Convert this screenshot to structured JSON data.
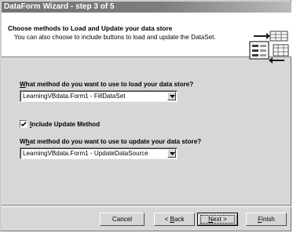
{
  "window": {
    "title": "DataForm Wizard - step 3 of 5"
  },
  "header": {
    "title": "Choose methods to Load and Update your data store",
    "subtitle": "You can also choose to include buttons to load and update the DataSet."
  },
  "load_section": {
    "label_accel": "W",
    "label_rest": "hat method do you want to use to load your data store?",
    "selected_value": "LearningVBdata.Form1  - FillDataSet"
  },
  "include_update": {
    "checked": true,
    "label_accel": "I",
    "label_rest": "nclude Update Method"
  },
  "update_section": {
    "label_prefix": "W",
    "label_accel": "h",
    "label_rest": "at method do you want to use to update your data store?",
    "selected_value": "LearningVBdata.Form1  - UpdateDataSource"
  },
  "buttons": {
    "cancel": "Cancel",
    "back_prefix": "< ",
    "back_accel": "B",
    "back_rest": "ack",
    "next_accel": "N",
    "next_rest": "ext >",
    "finish_accel": "F",
    "finish_rest": "inish"
  },
  "icons": {
    "wizard_graphic": "data-form-wizard-graphic-icon",
    "combo_arrow": "chevron-down-icon",
    "check": "check-icon"
  }
}
